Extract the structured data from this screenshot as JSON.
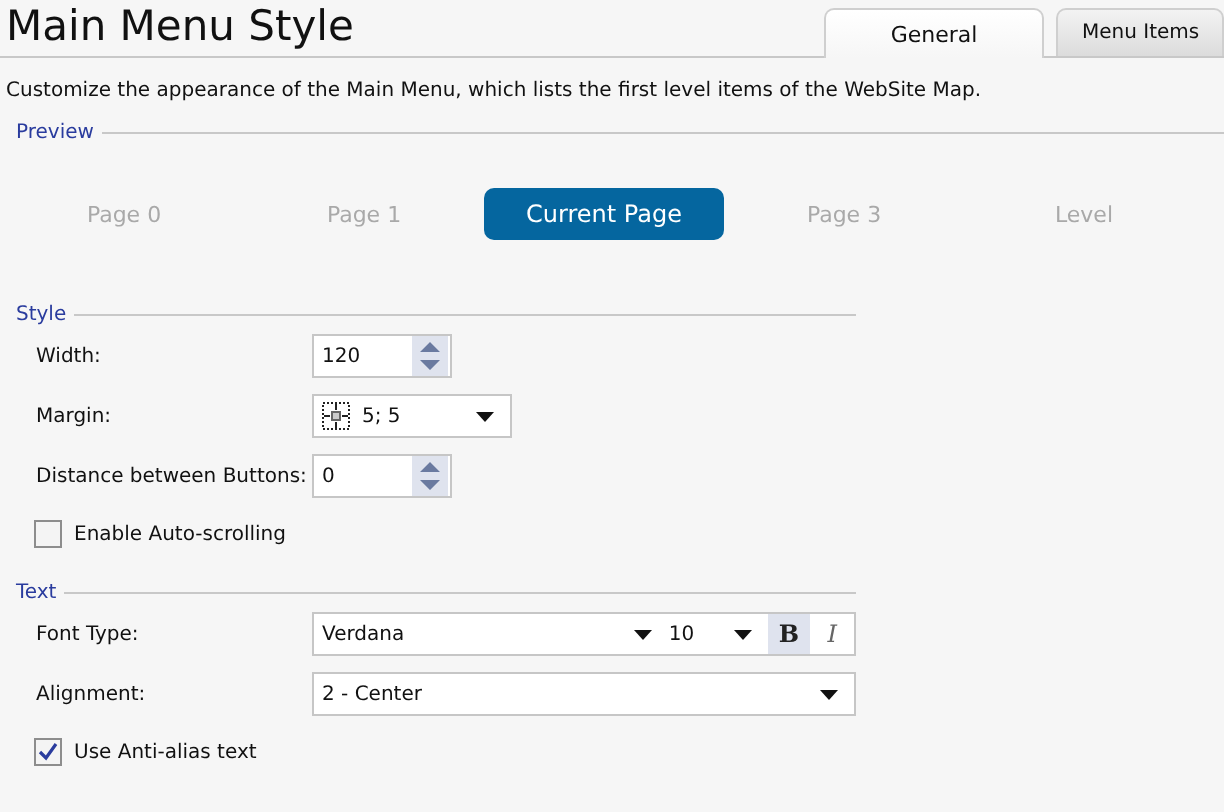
{
  "title": "Main Menu Style",
  "tabs": [
    {
      "label": "General",
      "selected": true
    },
    {
      "label": "Menu Items",
      "selected": false
    }
  ],
  "description": "Customize the appearance of the Main Menu, which lists the first level items of the WebSite Map.",
  "preview": {
    "heading": "Preview",
    "items": [
      {
        "label": "Page 0",
        "selected": false
      },
      {
        "label": "Page 1",
        "selected": false
      },
      {
        "label": "Current Page",
        "selected": true
      },
      {
        "label": "Page 3",
        "selected": false
      },
      {
        "label": "Level",
        "selected": false
      }
    ]
  },
  "style": {
    "heading": "Style",
    "width": {
      "label": "Width:",
      "value": "120"
    },
    "margin": {
      "label": "Margin:",
      "value": "5; 5"
    },
    "distance": {
      "label": "Distance between Buttons:",
      "value": "0"
    },
    "auto_scrolling": {
      "label": "Enable Auto-scrolling",
      "checked": false
    }
  },
  "text": {
    "heading": "Text",
    "font_type": {
      "label": "Font Type:",
      "font": "Verdana",
      "size": "10",
      "bold": {
        "label": "B",
        "on": true
      },
      "italic": {
        "label": "I",
        "on": false
      }
    },
    "alignment": {
      "label": "Alignment:",
      "value": "2 - Center"
    },
    "anti_alias": {
      "label": "Use Anti-alias text",
      "checked": true
    }
  }
}
